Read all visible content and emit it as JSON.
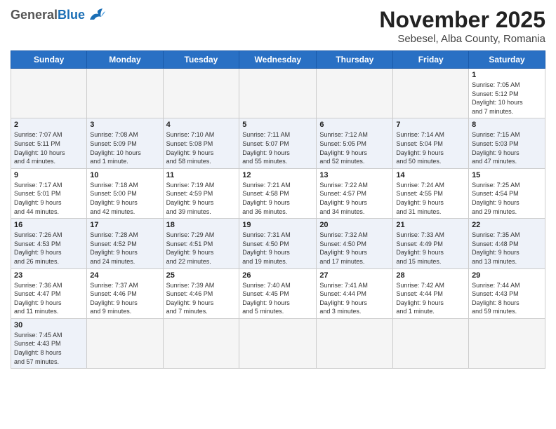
{
  "header": {
    "logo_general": "General",
    "logo_blue": "Blue",
    "month_title": "November 2025",
    "location": "Sebesel, Alba County, Romania"
  },
  "weekdays": [
    "Sunday",
    "Monday",
    "Tuesday",
    "Wednesday",
    "Thursday",
    "Friday",
    "Saturday"
  ],
  "weeks": [
    [
      {
        "day": "",
        "info": ""
      },
      {
        "day": "",
        "info": ""
      },
      {
        "day": "",
        "info": ""
      },
      {
        "day": "",
        "info": ""
      },
      {
        "day": "",
        "info": ""
      },
      {
        "day": "",
        "info": ""
      },
      {
        "day": "1",
        "info": "Sunrise: 7:05 AM\nSunset: 5:12 PM\nDaylight: 10 hours\nand 7 minutes."
      }
    ],
    [
      {
        "day": "2",
        "info": "Sunrise: 7:07 AM\nSunset: 5:11 PM\nDaylight: 10 hours\nand 4 minutes."
      },
      {
        "day": "3",
        "info": "Sunrise: 7:08 AM\nSunset: 5:09 PM\nDaylight: 10 hours\nand 1 minute."
      },
      {
        "day": "4",
        "info": "Sunrise: 7:10 AM\nSunset: 5:08 PM\nDaylight: 9 hours\nand 58 minutes."
      },
      {
        "day": "5",
        "info": "Sunrise: 7:11 AM\nSunset: 5:07 PM\nDaylight: 9 hours\nand 55 minutes."
      },
      {
        "day": "6",
        "info": "Sunrise: 7:12 AM\nSunset: 5:05 PM\nDaylight: 9 hours\nand 52 minutes."
      },
      {
        "day": "7",
        "info": "Sunrise: 7:14 AM\nSunset: 5:04 PM\nDaylight: 9 hours\nand 50 minutes."
      },
      {
        "day": "8",
        "info": "Sunrise: 7:15 AM\nSunset: 5:03 PM\nDaylight: 9 hours\nand 47 minutes."
      }
    ],
    [
      {
        "day": "9",
        "info": "Sunrise: 7:17 AM\nSunset: 5:01 PM\nDaylight: 9 hours\nand 44 minutes."
      },
      {
        "day": "10",
        "info": "Sunrise: 7:18 AM\nSunset: 5:00 PM\nDaylight: 9 hours\nand 42 minutes."
      },
      {
        "day": "11",
        "info": "Sunrise: 7:19 AM\nSunset: 4:59 PM\nDaylight: 9 hours\nand 39 minutes."
      },
      {
        "day": "12",
        "info": "Sunrise: 7:21 AM\nSunset: 4:58 PM\nDaylight: 9 hours\nand 36 minutes."
      },
      {
        "day": "13",
        "info": "Sunrise: 7:22 AM\nSunset: 4:57 PM\nDaylight: 9 hours\nand 34 minutes."
      },
      {
        "day": "14",
        "info": "Sunrise: 7:24 AM\nSunset: 4:55 PM\nDaylight: 9 hours\nand 31 minutes."
      },
      {
        "day": "15",
        "info": "Sunrise: 7:25 AM\nSunset: 4:54 PM\nDaylight: 9 hours\nand 29 minutes."
      }
    ],
    [
      {
        "day": "16",
        "info": "Sunrise: 7:26 AM\nSunset: 4:53 PM\nDaylight: 9 hours\nand 26 minutes."
      },
      {
        "day": "17",
        "info": "Sunrise: 7:28 AM\nSunset: 4:52 PM\nDaylight: 9 hours\nand 24 minutes."
      },
      {
        "day": "18",
        "info": "Sunrise: 7:29 AM\nSunset: 4:51 PM\nDaylight: 9 hours\nand 22 minutes."
      },
      {
        "day": "19",
        "info": "Sunrise: 7:31 AM\nSunset: 4:50 PM\nDaylight: 9 hours\nand 19 minutes."
      },
      {
        "day": "20",
        "info": "Sunrise: 7:32 AM\nSunset: 4:50 PM\nDaylight: 9 hours\nand 17 minutes."
      },
      {
        "day": "21",
        "info": "Sunrise: 7:33 AM\nSunset: 4:49 PM\nDaylight: 9 hours\nand 15 minutes."
      },
      {
        "day": "22",
        "info": "Sunrise: 7:35 AM\nSunset: 4:48 PM\nDaylight: 9 hours\nand 13 minutes."
      }
    ],
    [
      {
        "day": "23",
        "info": "Sunrise: 7:36 AM\nSunset: 4:47 PM\nDaylight: 9 hours\nand 11 minutes."
      },
      {
        "day": "24",
        "info": "Sunrise: 7:37 AM\nSunset: 4:46 PM\nDaylight: 9 hours\nand 9 minutes."
      },
      {
        "day": "25",
        "info": "Sunrise: 7:39 AM\nSunset: 4:46 PM\nDaylight: 9 hours\nand 7 minutes."
      },
      {
        "day": "26",
        "info": "Sunrise: 7:40 AM\nSunset: 4:45 PM\nDaylight: 9 hours\nand 5 minutes."
      },
      {
        "day": "27",
        "info": "Sunrise: 7:41 AM\nSunset: 4:44 PM\nDaylight: 9 hours\nand 3 minutes."
      },
      {
        "day": "28",
        "info": "Sunrise: 7:42 AM\nSunset: 4:44 PM\nDaylight: 9 hours\nand 1 minute."
      },
      {
        "day": "29",
        "info": "Sunrise: 7:44 AM\nSunset: 4:43 PM\nDaylight: 8 hours\nand 59 minutes."
      }
    ],
    [
      {
        "day": "30",
        "info": "Sunrise: 7:45 AM\nSunset: 4:43 PM\nDaylight: 8 hours\nand 57 minutes."
      },
      {
        "day": "",
        "info": ""
      },
      {
        "day": "",
        "info": ""
      },
      {
        "day": "",
        "info": ""
      },
      {
        "day": "",
        "info": ""
      },
      {
        "day": "",
        "info": ""
      },
      {
        "day": "",
        "info": ""
      }
    ]
  ]
}
